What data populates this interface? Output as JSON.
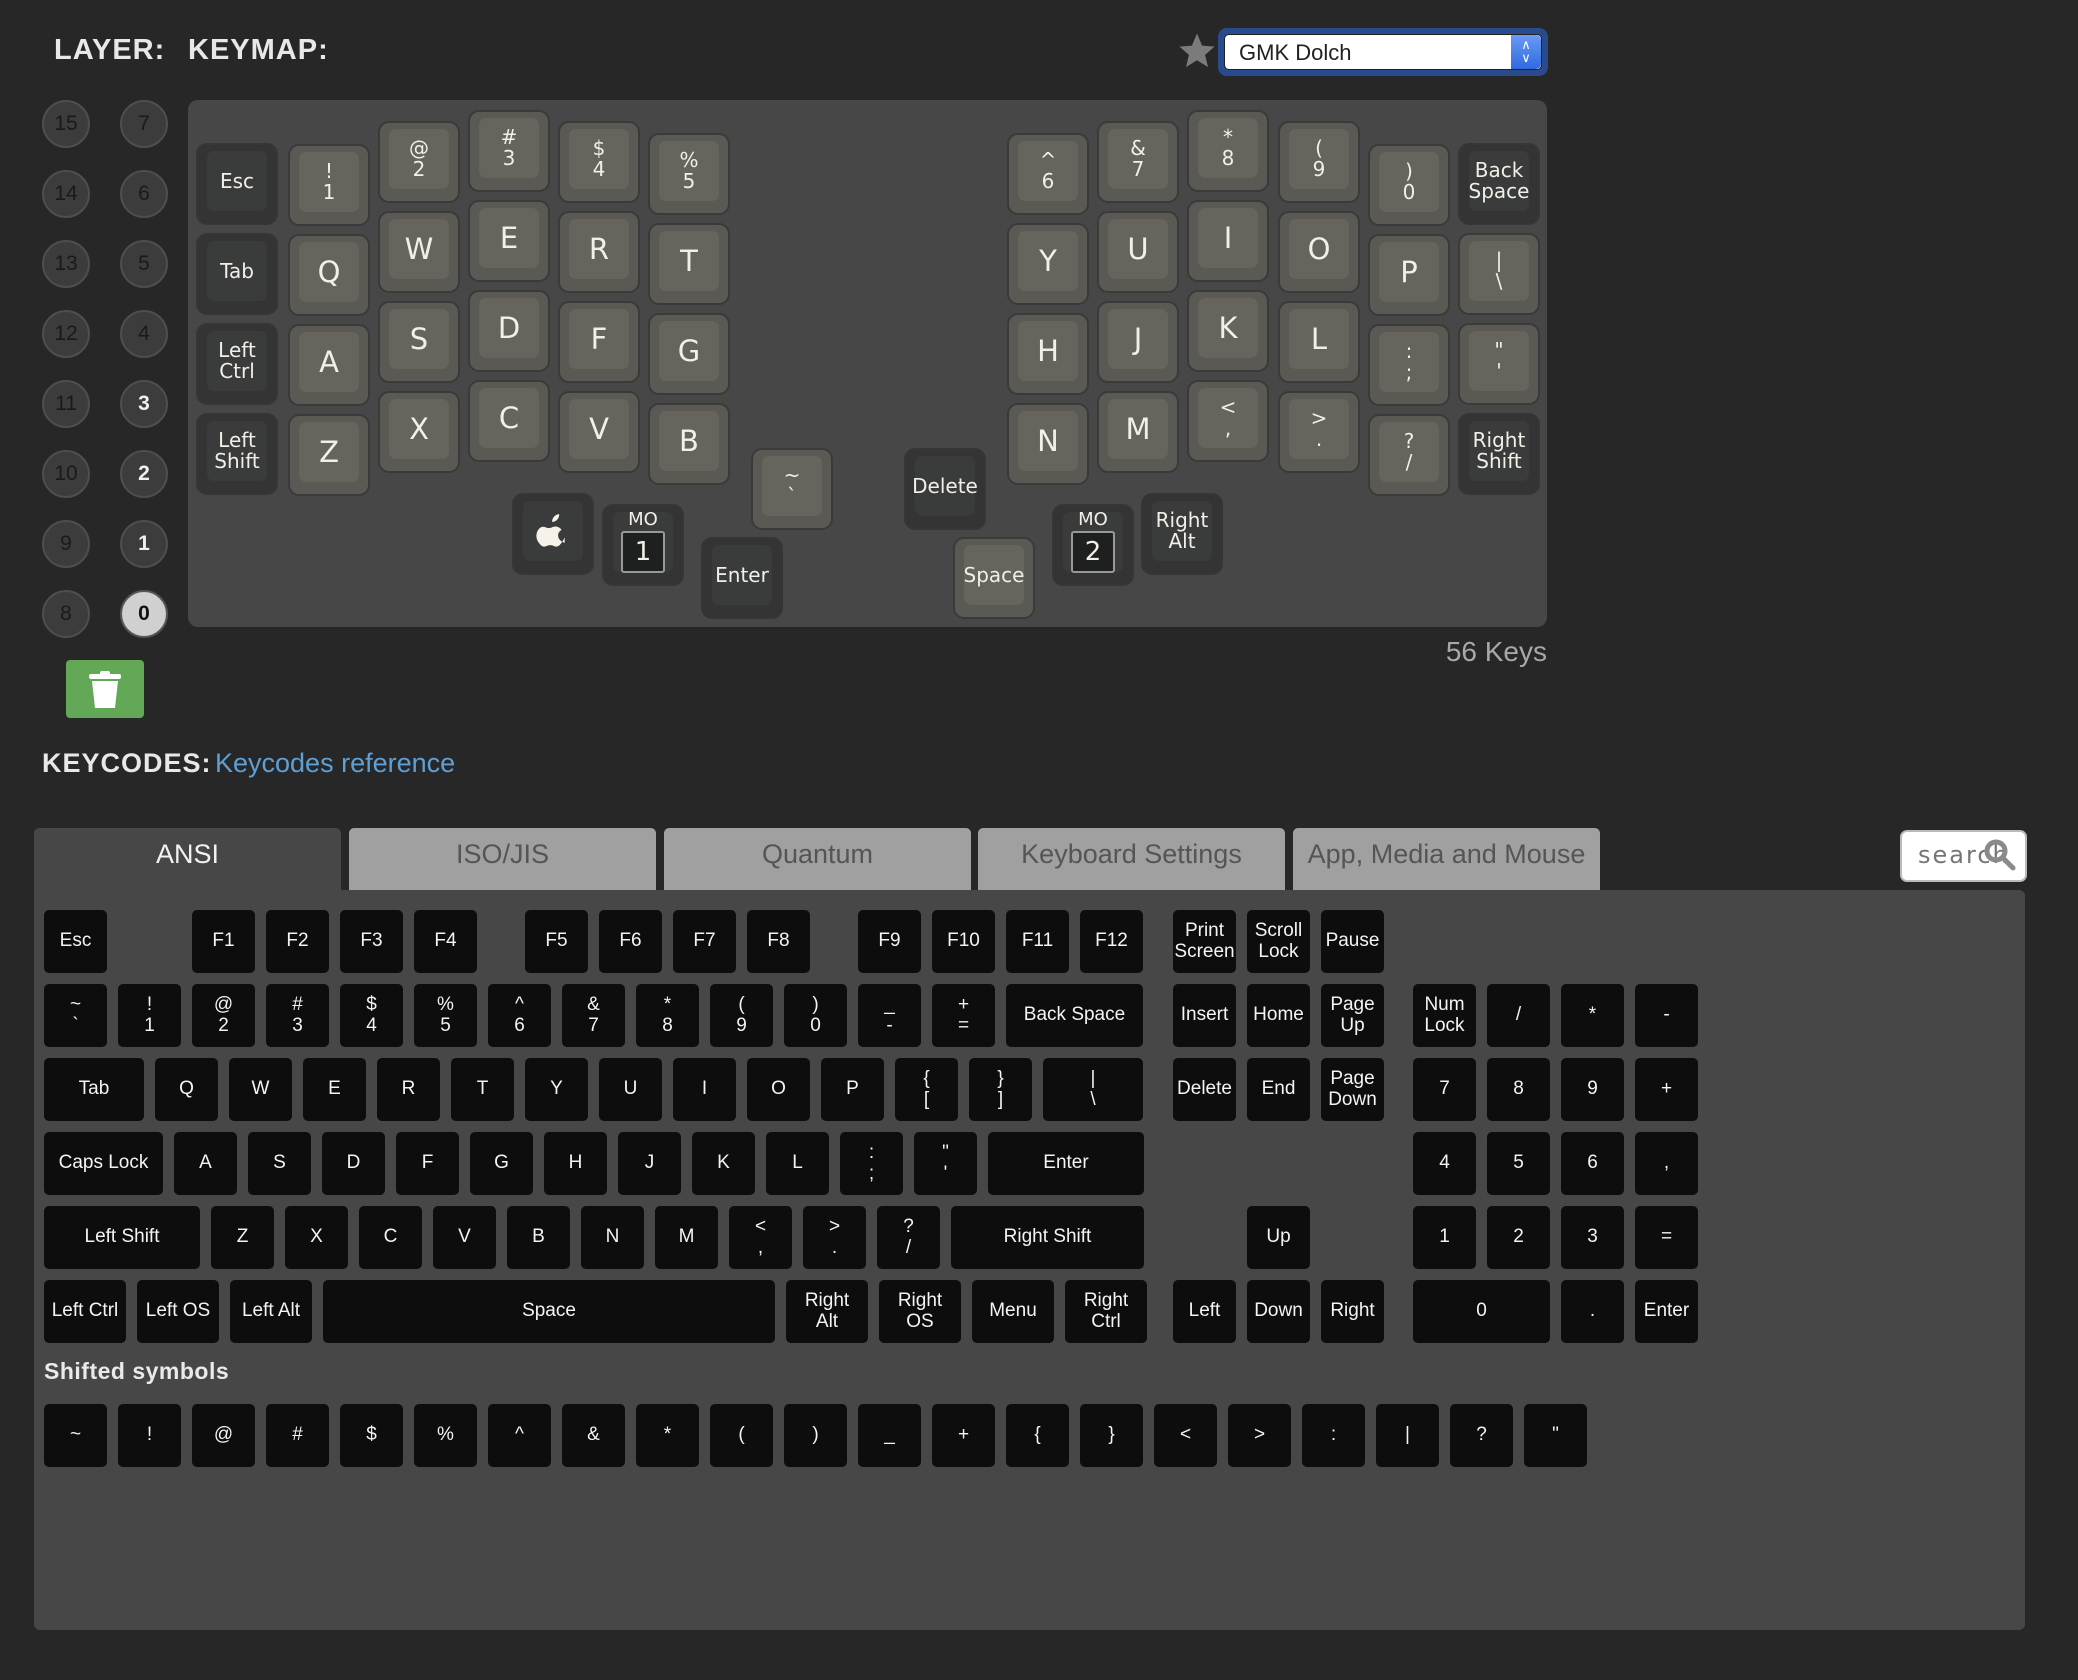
{
  "header": {
    "layer_label": "LAYER:",
    "keymap_label": "KEYMAP:",
    "favorite_icon": "star-icon",
    "keymap_select": {
      "value": "GMK Dolch"
    }
  },
  "layers": {
    "left_column": [
      "15",
      "14",
      "13",
      "12",
      "11",
      "10",
      "9",
      "8"
    ],
    "right_column": [
      "7",
      "6",
      "5",
      "4",
      "3",
      "2",
      "1",
      "0"
    ],
    "used": [
      "3",
      "2",
      "1",
      "0"
    ],
    "active": "0",
    "clear_icon": "trash-icon"
  },
  "keyboard": {
    "key_count": "56 Keys",
    "left": [
      [
        {
          "t": "Esc",
          "mod": true
        },
        {
          "t": "!\n1"
        },
        {
          "t": "@\n2"
        },
        {
          "t": "#\n3"
        },
        {
          "t": "$\n4"
        },
        {
          "t": "%\n5"
        }
      ],
      [
        {
          "t": "Tab",
          "mod": true
        },
        {
          "t": "Q"
        },
        {
          "t": "W"
        },
        {
          "t": "E"
        },
        {
          "t": "R"
        },
        {
          "t": "T"
        }
      ],
      [
        {
          "t": "Left\nCtrl",
          "mod": true
        },
        {
          "t": "A"
        },
        {
          "t": "S"
        },
        {
          "t": "D"
        },
        {
          "t": "F"
        },
        {
          "t": "G"
        }
      ],
      [
        {
          "t": "Left\nShift",
          "mod": true
        },
        {
          "t": "Z"
        },
        {
          "t": "X"
        },
        {
          "t": "C"
        },
        {
          "t": "V"
        },
        {
          "t": "B"
        }
      ]
    ],
    "right": [
      [
        {
          "t": "^\n6"
        },
        {
          "t": "&\n7"
        },
        {
          "t": "*\n8"
        },
        {
          "t": "(\n9"
        },
        {
          "t": ")\n0"
        },
        {
          "t": "Back\nSpace",
          "mod": true
        }
      ],
      [
        {
          "t": "Y"
        },
        {
          "t": "U"
        },
        {
          "t": "I"
        },
        {
          "t": "O"
        },
        {
          "t": "P"
        },
        {
          "t": "|\n\\"
        }
      ],
      [
        {
          "t": "H"
        },
        {
          "t": "J"
        },
        {
          "t": "K"
        },
        {
          "t": "L"
        },
        {
          "t": ":\n;"
        },
        {
          "t": "\"\n'"
        }
      ],
      [
        {
          "t": "N"
        },
        {
          "t": "M"
        },
        {
          "t": "<\n,"
        },
        {
          "t": ">\n."
        },
        {
          "t": "?\n/"
        },
        {
          "t": "Right\nShift",
          "mod": true
        }
      ]
    ],
    "thumbs": [
      {
        "t": "apple",
        "mod": true,
        "icon": "apple-icon"
      },
      {
        "t": "MO",
        "layer": "1",
        "mod": true
      },
      {
        "t": "Enter",
        "mod": true
      },
      {
        "t": "~\n`"
      },
      {
        "t": "Delete",
        "mod": true
      },
      {
        "t": "Space"
      },
      {
        "t": "MO",
        "layer": "2",
        "mod": true
      },
      {
        "t": "Right\nAlt",
        "mod": true
      }
    ]
  },
  "keycodes": {
    "label": "KEYCODES:",
    "reference_link": "Keycodes reference",
    "tabs": [
      "ANSI",
      "ISO/JIS",
      "Quantum",
      "Keyboard Settings",
      "App, Media and Mouse"
    ],
    "active_tab": "ANSI",
    "search": {
      "placeholder": "search",
      "icon": "search-icon"
    },
    "ansi_rows": [
      [
        [
          "Esc",
          1
        ],
        [
          null,
          1
        ],
        [
          "F1",
          1
        ],
        [
          "F2",
          1
        ],
        [
          "F3",
          1
        ],
        [
          "F4",
          1
        ],
        [
          null,
          0.5
        ],
        [
          "F5",
          1
        ],
        [
          "F6",
          1
        ],
        [
          "F7",
          1
        ],
        [
          "F8",
          1
        ],
        [
          null,
          0.5
        ],
        [
          "F9",
          1
        ],
        [
          "F10",
          1
        ],
        [
          "F11",
          1
        ],
        [
          "F12",
          1
        ]
      ],
      [
        [
          "~\n`",
          1
        ],
        [
          "!\n1",
          1
        ],
        [
          "@\n2",
          1
        ],
        [
          "#\n3",
          1
        ],
        [
          "$\n4",
          1
        ],
        [
          "%\n5",
          1
        ],
        [
          "^\n6",
          1
        ],
        [
          "&\n7",
          1
        ],
        [
          "*\n8",
          1
        ],
        [
          "(\n9",
          1
        ],
        [
          ")\n0",
          1
        ],
        [
          "_\n-",
          1
        ],
        [
          "+\n=",
          1
        ],
        [
          "Back Space",
          2
        ]
      ],
      [
        [
          "Tab",
          1.5
        ],
        [
          "Q",
          1
        ],
        [
          "W",
          1
        ],
        [
          "E",
          1
        ],
        [
          "R",
          1
        ],
        [
          "T",
          1
        ],
        [
          "Y",
          1
        ],
        [
          "U",
          1
        ],
        [
          "I",
          1
        ],
        [
          "O",
          1
        ],
        [
          "P",
          1
        ],
        [
          "{\n[",
          1
        ],
        [
          "}\n]",
          1
        ],
        [
          "|\n\\",
          1.5
        ]
      ],
      [
        [
          "Caps Lock",
          1.75
        ],
        [
          "A",
          1
        ],
        [
          "S",
          1
        ],
        [
          "D",
          1
        ],
        [
          "F",
          1
        ],
        [
          "G",
          1
        ],
        [
          "H",
          1
        ],
        [
          "J",
          1
        ],
        [
          "K",
          1
        ],
        [
          "L",
          1
        ],
        [
          ":\n;",
          1
        ],
        [
          "\"\n'",
          1
        ],
        [
          "Enter",
          2.25
        ]
      ],
      [
        [
          "Left Shift",
          2.25
        ],
        [
          "Z",
          1
        ],
        [
          "X",
          1
        ],
        [
          "C",
          1
        ],
        [
          "V",
          1
        ],
        [
          "B",
          1
        ],
        [
          "N",
          1
        ],
        [
          "M",
          1
        ],
        [
          "<\n,",
          1
        ],
        [
          ">\n.",
          1
        ],
        [
          "?\n/",
          1
        ],
        [
          "Right Shift",
          2.75
        ]
      ],
      [
        [
          "Left Ctrl",
          1.25
        ],
        [
          "Left OS",
          1.25
        ],
        [
          "Left Alt",
          1.25
        ],
        [
          "Space",
          6.25
        ],
        [
          "Right\nAlt",
          1.25
        ],
        [
          "Right\nOS",
          1.25
        ],
        [
          "Menu",
          1.25
        ],
        [
          "Right\nCtrl",
          1.25
        ]
      ]
    ],
    "nav_cluster": [
      [
        "Print\nScreen",
        "Scroll\nLock",
        "Pause"
      ],
      [
        "Insert",
        "Home",
        "Page\nUp"
      ],
      [
        "Delete",
        "End",
        "Page\nDown"
      ],
      [
        null,
        null,
        null
      ],
      [
        null,
        "Up",
        null
      ],
      [
        "Left",
        "Down",
        "Right"
      ]
    ],
    "numpad": [
      [],
      [
        "Num\nLock",
        "/",
        "*",
        "-"
      ],
      [
        "7",
        "8",
        "9",
        "+"
      ],
      [
        "4",
        "5",
        "6",
        ","
      ],
      [
        "1",
        "2",
        "3",
        "="
      ],
      [
        "0",
        ".",
        "Enter"
      ]
    ],
    "shifted_title": "Shifted symbols",
    "shifted_symbols": [
      "~",
      "!",
      "@",
      "#",
      "$",
      "%",
      "^",
      "&",
      "*",
      "(",
      ")",
      "_",
      "+",
      "{",
      "}",
      "<",
      ">",
      ":",
      "|",
      "?",
      "\""
    ]
  }
}
